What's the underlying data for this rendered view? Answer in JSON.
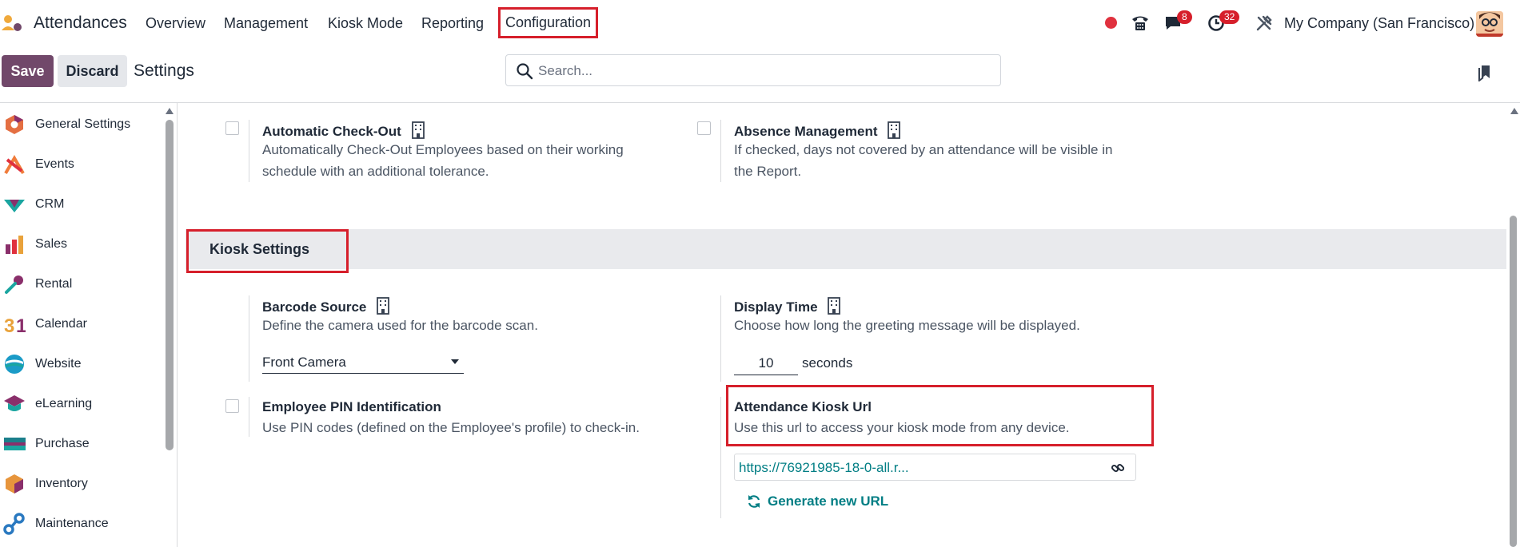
{
  "app": {
    "name": "Attendances"
  },
  "nav": {
    "menus": [
      "Overview",
      "Management",
      "Kiosk Mode",
      "Reporting",
      "Configuration"
    ],
    "active": "Configuration",
    "badges": {
      "messages": "8",
      "activities": "32"
    },
    "company": "My Company (San Francisco)"
  },
  "toolbar": {
    "save_label": "Save",
    "discard_label": "Discard",
    "title": "Settings",
    "search_placeholder": "Search..."
  },
  "sidebar": {
    "items": [
      {
        "label": "General Settings",
        "icon": "general-settings-icon",
        "color": "#e46f42"
      },
      {
        "label": "Events",
        "icon": "events-icon",
        "color": "#f07c3b"
      },
      {
        "label": "CRM",
        "icon": "crm-icon",
        "color": "#1aa5a0"
      },
      {
        "label": "Sales",
        "icon": "sales-icon",
        "color": "#e9a23b"
      },
      {
        "label": "Rental",
        "icon": "rental-icon",
        "color": "#5b8fd6"
      },
      {
        "label": "Calendar",
        "icon": "calendar-icon",
        "color": "#e9a23b"
      },
      {
        "label": "Website",
        "icon": "website-icon",
        "color": "#1b9bc7"
      },
      {
        "label": "eLearning",
        "icon": "elearning-icon",
        "color": "#8a2f6b"
      },
      {
        "label": "Purchase",
        "icon": "purchase-icon",
        "color": "#1b7f8b"
      },
      {
        "label": "Inventory",
        "icon": "inventory-icon",
        "color": "#e7953c"
      },
      {
        "label": "Maintenance",
        "icon": "maintenance-icon",
        "color": "#2a79c0"
      }
    ]
  },
  "settings": {
    "auto_checkout": {
      "title": "Automatic Check-Out",
      "desc1": "Automatically Check-Out Employees based on their working",
      "desc2": "schedule with an additional tolerance."
    },
    "absence": {
      "title": "Absence Management",
      "desc1": "If checked, days not covered by an attendance will be visible in",
      "desc2": "the Report."
    },
    "kiosk_section": "Kiosk Settings",
    "barcode": {
      "title": "Barcode Source",
      "desc": "Define the camera used for the barcode scan.",
      "value": "Front Camera"
    },
    "display_time": {
      "title": "Display Time",
      "desc": "Choose how long the greeting message will be displayed.",
      "value": "10",
      "unit": "seconds"
    },
    "pin": {
      "title": "Employee PIN Identification",
      "desc": "Use PIN codes (defined on the Employee's profile) to check-in."
    },
    "kiosk_url": {
      "title": "Attendance Kiosk Url",
      "desc": "Use this url to access your kiosk mode from any device.",
      "url": "https://76921985-18-0-all.r...",
      "generate_label": "Generate new URL"
    }
  },
  "colors": {
    "primary": "#71486a",
    "link": "#017e84",
    "highlight": "#d61f2b",
    "badge": "#d61f2b"
  }
}
